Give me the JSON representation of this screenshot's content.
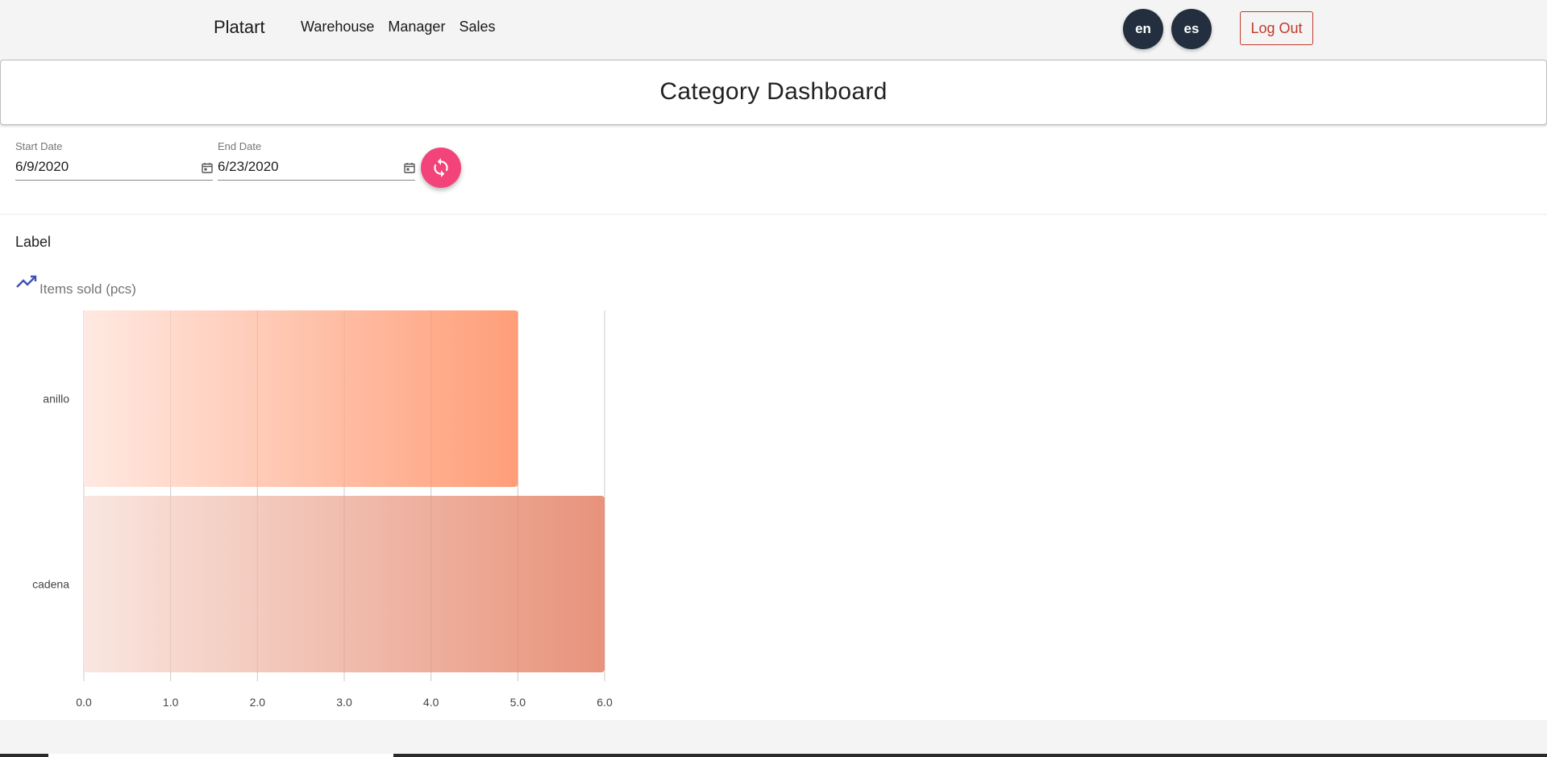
{
  "navbar": {
    "brand": "Platart",
    "links": [
      "Warehouse",
      "Manager",
      "Sales"
    ],
    "lang_en": "en",
    "lang_es": "es",
    "logout_label": "Log Out",
    "lang_button_color": "#232f3e",
    "logout_color": "#c0392b"
  },
  "page": {
    "title": "Category Dashboard"
  },
  "filters": {
    "start_label": "Start Date",
    "start_value": "6/9/2020",
    "end_label": "End Date",
    "end_value": "6/23/2020",
    "refresh_icon": "refresh-icon",
    "calendar_icon": "calendar-icon",
    "refresh_color": "#f2447a"
  },
  "card": {
    "label": "Label",
    "chart_icon": "trending-up-icon"
  },
  "chart_data": {
    "type": "bar",
    "orientation": "horizontal",
    "title": "Items sold (pcs)",
    "categories": [
      "anillo",
      "cadena"
    ],
    "values": [
      5,
      6
    ],
    "xlim": [
      0,
      6
    ],
    "x_ticks": [
      "0.0",
      "1.0",
      "2.0",
      "3.0",
      "4.0",
      "5.0",
      "6.0"
    ],
    "grid": true,
    "colors": [
      {
        "from": "#ffe9e2",
        "to": "#ff9e78"
      },
      {
        "from": "#f9e6e0",
        "to": "#e8937b"
      }
    ]
  }
}
